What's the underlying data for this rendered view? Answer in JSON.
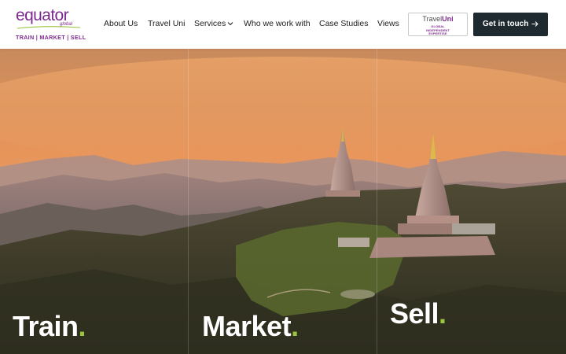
{
  "brand": {
    "name": "equator",
    "sub": "global",
    "tagline": "TRAIN | MARKET | SELL"
  },
  "nav": {
    "items": [
      {
        "label": "About Us"
      },
      {
        "label": "Travel Uni"
      },
      {
        "label": "Services"
      },
      {
        "label": "Who we work with"
      },
      {
        "label": "Case Studies"
      },
      {
        "label": "Views"
      }
    ]
  },
  "badge": {
    "title_a": "Travel",
    "title_b": "Uni",
    "line1": "GLOBAL",
    "line2": "INDEPENDENT",
    "line3": "EXPERTISE"
  },
  "cta": {
    "label": "Get in touch"
  },
  "hero": {
    "columns": [
      {
        "word": "Train",
        "dot": "."
      },
      {
        "word": "Market",
        "dot": "."
      },
      {
        "word": "Sell",
        "dot": "."
      }
    ]
  },
  "colors": {
    "brand_purple": "#7d2a8f",
    "accent_green": "#9bc53d",
    "cta_dark": "#1f2a30"
  },
  "icons": [
    "chevron-down-icon",
    "arrow-right-icon"
  ]
}
